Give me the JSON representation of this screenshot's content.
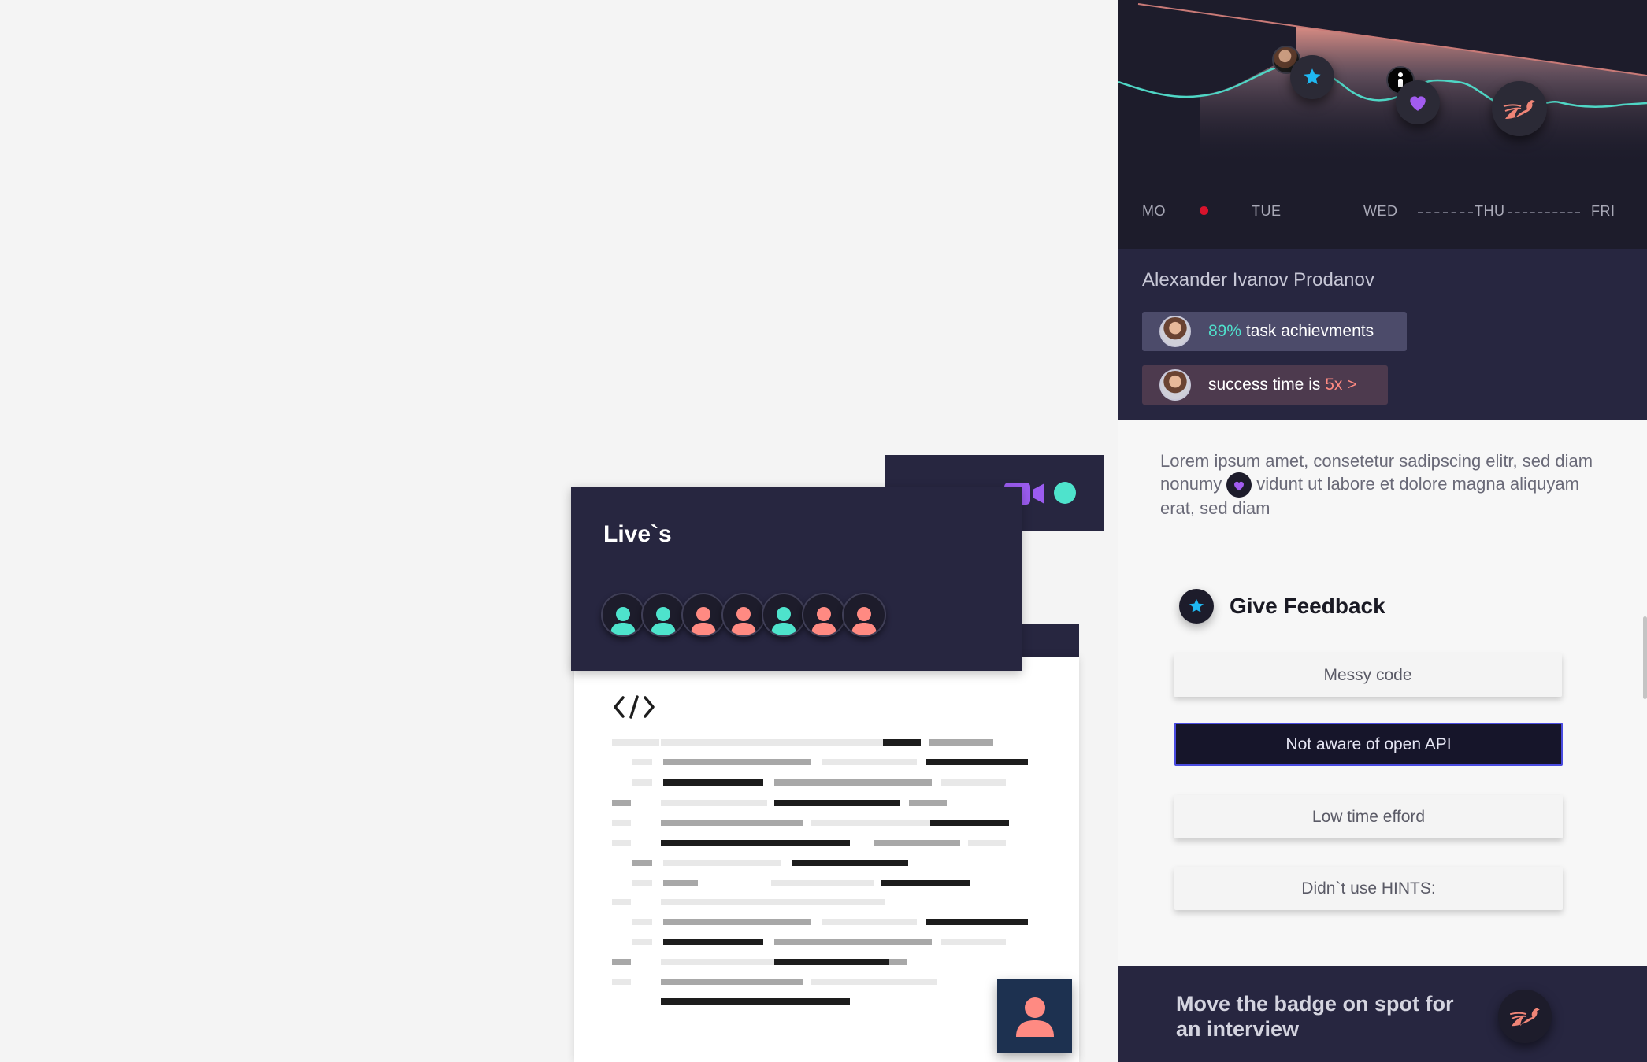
{
  "chart": {
    "days": [
      "MO",
      "TUE",
      "WED",
      "THU",
      "FRI"
    ],
    "colors": {
      "line": "#4fd6c5",
      "area_top": "#f09a8e",
      "background": "#1d1c2b",
      "today_marker": "#d8132c"
    },
    "markers": [
      "person-avatar",
      "star-icon",
      "info-avatar",
      "heart-icon",
      "phoenix-icon"
    ]
  },
  "profile": {
    "name": "Alexander Ivanov Prodanov",
    "stats": [
      {
        "highlight": "89%",
        "text": " task achievments"
      },
      {
        "text": "success time is ",
        "highlight": "5x >"
      }
    ]
  },
  "description": {
    "part1": "Lorem ipsum amet, consetetur sadipscing elitr, sed diam nonumy",
    "part2": "vidunt ut labore et dolore magna aliquyam erat, sed diam"
  },
  "feedback": {
    "title": "Give Feedback",
    "options": [
      "Messy code",
      "Not aware of open API",
      "Low time efford",
      "Didn`t use HINTS:"
    ],
    "selected": "Not aware of open API"
  },
  "interview": {
    "text": "Move the badge on spot for an interview"
  },
  "lives": {
    "title": "Live`s",
    "participants": [
      "teal",
      "teal",
      "salmon",
      "salmon",
      "teal",
      "salmon",
      "salmon"
    ],
    "colors": {
      "teal": "#4ee3cc",
      "salmon": "#ff8a82",
      "video": "#9b5cf0"
    }
  }
}
